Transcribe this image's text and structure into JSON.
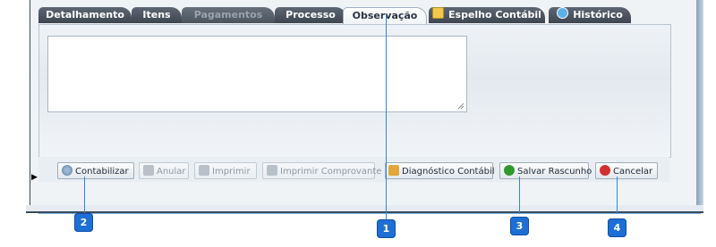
{
  "tabs": [
    {
      "label": "Detalhamento",
      "state": "normal"
    },
    {
      "label": "Itens",
      "state": "normal"
    },
    {
      "label": "Pagamentos",
      "state": "disabled"
    },
    {
      "label": "Processo",
      "state": "normal"
    },
    {
      "label": "Observação",
      "state": "active"
    },
    {
      "label": "Espelho Contábil",
      "state": "normal",
      "icon": "ledger-icon"
    },
    {
      "label": "Histórico",
      "state": "normal",
      "icon": "history-icon"
    }
  ],
  "observation": {
    "value": ""
  },
  "buttons": {
    "contabilizar": "Contabilizar",
    "anular": "Anular",
    "imprimir": "Imprimir",
    "imprimir_comprovante": "Imprimir Comprovante",
    "diagnostico": "Diagnóstico Contábil",
    "salvar_rascunho": "Salvar Rascunho",
    "cancelar": "Cancelar"
  },
  "callouts": [
    "1",
    "2",
    "3",
    "4"
  ],
  "colors": {
    "callout": "#1d6fd6",
    "tab_dark": "#3d4550",
    "save_green": "#2e9a2e",
    "cancel_red": "#d23030"
  }
}
